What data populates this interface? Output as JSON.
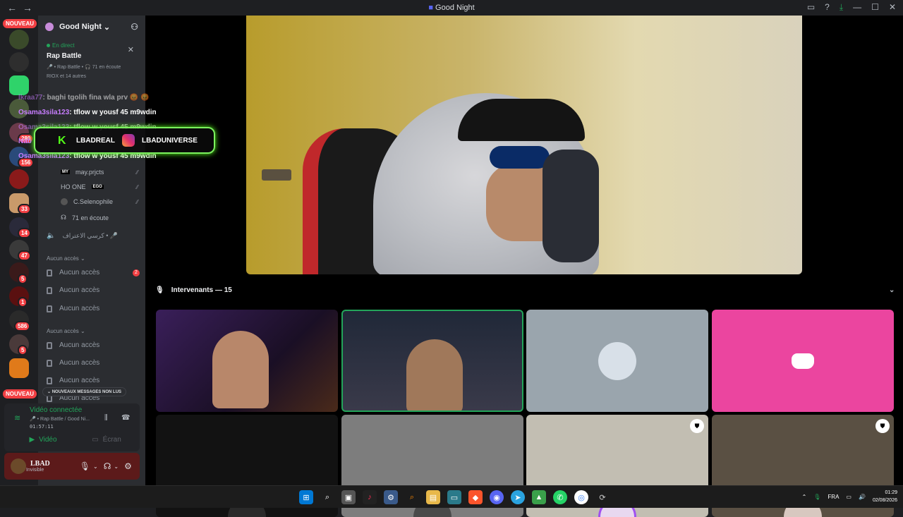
{
  "window": {
    "title": "Good Night",
    "back": "←",
    "forward": "→"
  },
  "rail": {
    "nouveau_top": "NOUVEAU",
    "nouveau_bottom": "NOUVEAU",
    "badges": [
      "280",
      "156",
      "33",
      "14",
      "47",
      "5",
      "1",
      "586",
      "5"
    ]
  },
  "server": {
    "name": "Good Night",
    "chevron": "⌄"
  },
  "live": {
    "status": "En direct",
    "channel": "Rap Battle",
    "meta": "🎤 • Rap Battle • 🎧 71 en écoute",
    "listeners": "RIOX et 14 autres"
  },
  "members": [
    {
      "name": "may.prjcts",
      "tag": "MY"
    },
    {
      "name": "HO ONE",
      "tag": "EGO"
    },
    {
      "name": "C.Selenophile",
      "tag": ""
    },
    {
      "name": "71 en écoute",
      "tag": ""
    }
  ],
  "arabic_channel": "كرسي الاعتراف • 🎤",
  "categories": [
    {
      "label": "Aucun accès",
      "channels": [
        "Aucun accès",
        "Aucun accès",
        "Aucun accès"
      ],
      "count": "2"
    },
    {
      "label": "Aucun accès",
      "channels": [
        "Aucun accès",
        "Aucun accès",
        "Aucun accès",
        "Aucun accès"
      ]
    }
  ],
  "unread": "NOUVEAUX MESSAGES NON LUS",
  "chat_overlay": [
    {
      "user": "lkraa77",
      "msg": ": baghi tgolih fina wla prv 😡 😡"
    },
    {
      "user": "Osama3sila123",
      "msg": ": tflow w yousf 45 m9wdin"
    },
    {
      "user": "Osama3sila123",
      "msg": ": tflow w yousf 45 m9wdin"
    },
    {
      "user": "Nab",
      "msg": ""
    },
    {
      "user": "Osama3sila123",
      "msg": ": tflow w yousf 45 m9wdin"
    }
  ],
  "banner": {
    "kick": "LBADREAL",
    "instagram": "LBADUNIVERSE"
  },
  "voice": {
    "status": "Vidéo connectée",
    "location": "🎤 • Rap Battle / Good Ni...",
    "time": "01:57:11",
    "video_label": "Vidéo",
    "screen_label": "Écran"
  },
  "user": {
    "name": "LBAD",
    "status": "Invisible"
  },
  "speakers": {
    "label": "Intervenants — 15"
  },
  "tiles": [
    {
      "kind": "camera",
      "bg": "#2a1b3d"
    },
    {
      "kind": "camera",
      "bg": "#1f2a3a",
      "speaking": true
    },
    {
      "kind": "avatar",
      "bg": "#9aa5ad"
    },
    {
      "kind": "discord",
      "bg": "#eb459f"
    },
    {
      "kind": "avatar",
      "bg": "#121212"
    },
    {
      "kind": "avatar",
      "bg": "#7d7d7d"
    },
    {
      "kind": "avatar",
      "bg": "#c2beb2"
    },
    {
      "kind": "avatar",
      "bg": "#5a5043"
    }
  ],
  "taskbar": {
    "lang": "FRA",
    "time": "01:29",
    "date": "02/08/2026"
  },
  "colors": {
    "accent_green": "#23a55a",
    "kick_green": "#53fc18",
    "danger": "#f23f43",
    "discord_pink": "#eb459f"
  }
}
